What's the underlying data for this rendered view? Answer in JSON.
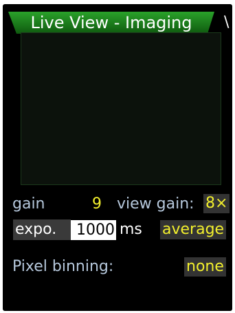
{
  "header": {
    "title": "Live View - Imaging",
    "next_tab_glyph": "\\",
    "accent_color": "#1e8a1e"
  },
  "controls": {
    "gain_label": "gain",
    "gain_value": "9",
    "view_gain_label": "view gain:",
    "view_gain_value": "8×",
    "expo_label": "expo.",
    "expo_value": "1000",
    "expo_unit": "ms",
    "average_label": "average",
    "binning_label": "Pixel binning:",
    "binning_value": "none"
  },
  "colors": {
    "value_yellow": "#f3f02d",
    "label_blue": "#b6c8dc",
    "chip_bg": "#333333"
  }
}
